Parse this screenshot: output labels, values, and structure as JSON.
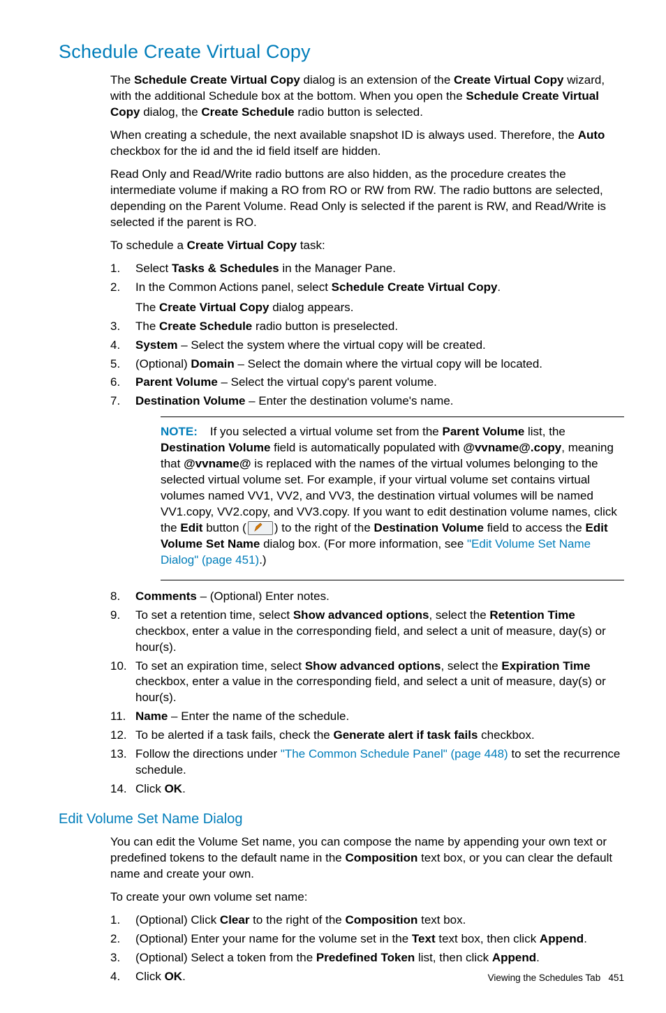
{
  "section1": {
    "title": "Schedule Create Virtual Copy",
    "p1": {
      "a": "The ",
      "b": "Schedule Create Virtual Copy",
      "c": " dialog is an extension of the ",
      "d": "Create Virtual Copy",
      "e": " wizard, with the additional Schedule box at the bottom. When you open the ",
      "f": "Schedule Create Virtual Copy",
      "g": " dialog, the ",
      "h": "Create Schedule",
      "i": " radio button is selected."
    },
    "p2": {
      "a": "When creating a schedule, the next available snapshot ID is always used. Therefore, the ",
      "b": "Auto",
      "c": " checkbox for the id and the id field itself are hidden."
    },
    "p3": "Read Only and Read/Write radio buttons are also hidden, as the procedure creates the intermediate volume if making a RO from RO or RW from RW. The radio buttons are selected, depending on the Parent Volume. Read Only is selected if the parent is RW, and Read/Write is selected if the parent is RO.",
    "p4": {
      "a": "To schedule a ",
      "b": "Create Virtual Copy",
      "c": " task:"
    },
    "list": {
      "i1": {
        "n": "1.",
        "a": "Select ",
        "b": "Tasks & Schedules",
        "c": " in the Manager Pane."
      },
      "i2": {
        "n": "2.",
        "a": "In the Common Actions panel, select ",
        "b": "Schedule Create Virtual Copy",
        "c": ".",
        "sub_a": "The ",
        "sub_b": "Create Virtual Copy",
        "sub_c": " dialog appears."
      },
      "i3": {
        "n": "3.",
        "a": "The ",
        "b": "Create Schedule",
        "c": " radio button is preselected."
      },
      "i4": {
        "n": "4.",
        "b": "System",
        "c": " – Select the system where the virtual copy will be created."
      },
      "i5": {
        "n": "5.",
        "a": "(Optional) ",
        "b": "Domain",
        "c": " – Select the domain where the virtual copy will be located."
      },
      "i6": {
        "n": "6.",
        "b": "Parent Volume",
        "c": " – Select the virtual copy's parent volume."
      },
      "i7": {
        "n": "7.",
        "b": "Destination Volume",
        "c": " – Enter the destination volume's name."
      },
      "i8": {
        "n": "8.",
        "b": "Comments",
        "c": " – (Optional) Enter notes."
      },
      "i9": {
        "n": "9.",
        "a": "To set a retention time, select ",
        "b": "Show advanced options",
        "c": ", select the ",
        "d": "Retention Time",
        "e": " checkbox, enter a value in the corresponding field, and select a unit of measure, day(s) or hour(s)."
      },
      "i10": {
        "n": "10.",
        "a": "To set an expiration time, select ",
        "b": "Show advanced options",
        "c": ", select the ",
        "d": "Expiration Time",
        "e": " checkbox, enter a value in the corresponding field, and select a unit of measure, day(s) or hour(s)."
      },
      "i11": {
        "n": "11.",
        "b": "Name",
        "c": " – Enter the name of the schedule."
      },
      "i12": {
        "n": "12.",
        "a": "To be alerted if a task fails, check the ",
        "b": "Generate alert if task fails",
        "c": " checkbox."
      },
      "i13": {
        "n": "13.",
        "a": "Follow the directions under ",
        "link": "\"The Common Schedule Panel\" (page 448)",
        "c": " to set the recurrence schedule."
      },
      "i14": {
        "n": "14.",
        "a": "Click ",
        "b": "OK",
        "c": "."
      }
    },
    "note": {
      "label": "NOTE:",
      "a": "If you selected a virtual volume set from the ",
      "b": "Parent Volume",
      "c": " list, the ",
      "d": "Destination Volume",
      "e": " field is automatically populated with ",
      "f": "@vvname@.copy",
      "g": ", meaning that ",
      "h": "@vvname@",
      "i": " is replaced with the names of the virtual volumes belonging to the selected virtual volume set. For example, if your virtual volume set contains virtual volumes named VV1, VV2, and VV3, the destination virtual volumes will be named VV1.copy, VV2.copy, and VV3.copy. If you want to edit destination volume names, click the ",
      "j": "Edit",
      "k": " button (",
      "l": ") to the right of the ",
      "m": "Destination Volume",
      "n": " field to access the ",
      "o": "Edit Volume Set Name",
      "p": " dialog box. (For more information, see ",
      "link": "\"Edit Volume Set Name Dialog\" (page 451)",
      "q": ".)"
    }
  },
  "section2": {
    "title": "Edit Volume Set Name Dialog",
    "p1": {
      "a": "You can edit the Volume Set name, you can compose the name by appending your own text or predefined tokens to the default name in the ",
      "b": "Composition",
      "c": " text box, or you can clear the default name and create your own."
    },
    "p2": "To create your own volume set name:",
    "list": {
      "i1": {
        "n": "1.",
        "a": "(Optional) Click ",
        "b": "Clear",
        "c": " to the right of the ",
        "d": "Composition",
        "e": " text box."
      },
      "i2": {
        "n": "2.",
        "a": "(Optional) Enter your name for the volume set in the ",
        "b": "Text",
        "c": " text box, then click ",
        "d": "Append",
        "e": "."
      },
      "i3": {
        "n": "3.",
        "a": "(Optional) Select a token from the ",
        "b": "Predefined Token",
        "c": " list, then click ",
        "d": "Append",
        "e": "."
      },
      "i4": {
        "n": "4.",
        "a": "Click ",
        "b": "OK",
        "c": "."
      }
    }
  },
  "footer": {
    "text": "Viewing the Schedules Tab",
    "page": "451"
  }
}
